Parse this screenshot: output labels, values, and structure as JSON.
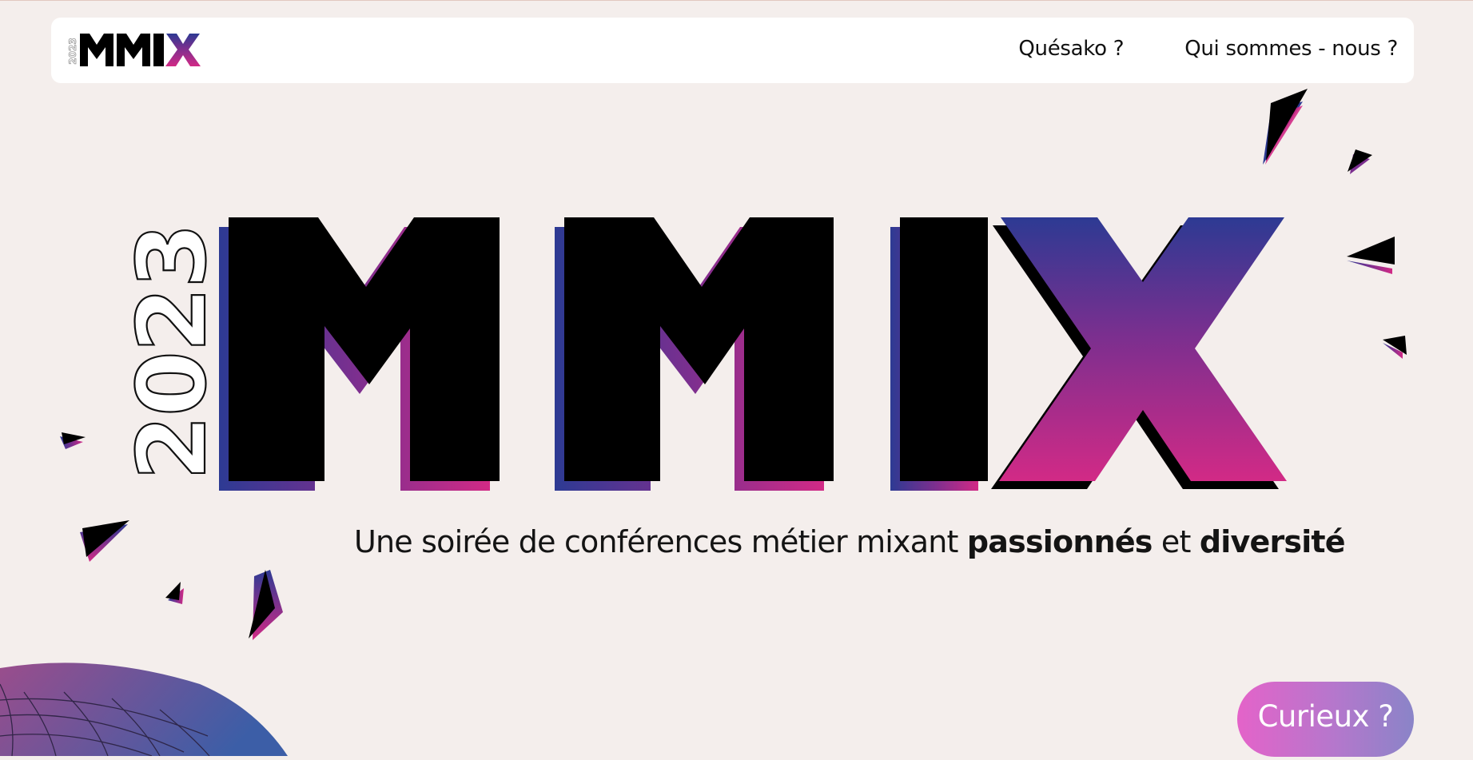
{
  "brand": {
    "logo_text": "MMIX",
    "logo_year": "2023",
    "accent_blue": "#2d3a93",
    "accent_purple": "#7b2f8f",
    "accent_pink": "#d22a86",
    "background": "#f4eeec"
  },
  "nav": {
    "links": [
      {
        "label": "Quésako ?"
      },
      {
        "label": "Qui sommes - nous ?"
      }
    ]
  },
  "hero": {
    "year": "2023",
    "title": "MMIX",
    "tagline_prefix": "Une soirée de conférences métier mixant ",
    "tagline_bold_1": "passionnés",
    "tagline_mid": " et ",
    "tagline_bold_2": "diversité"
  },
  "cta": {
    "label": "Curieux ?"
  },
  "decor": {
    "shard_icon": "triangle-shard-icon",
    "globe_icon": "wireframe-globe-icon"
  }
}
